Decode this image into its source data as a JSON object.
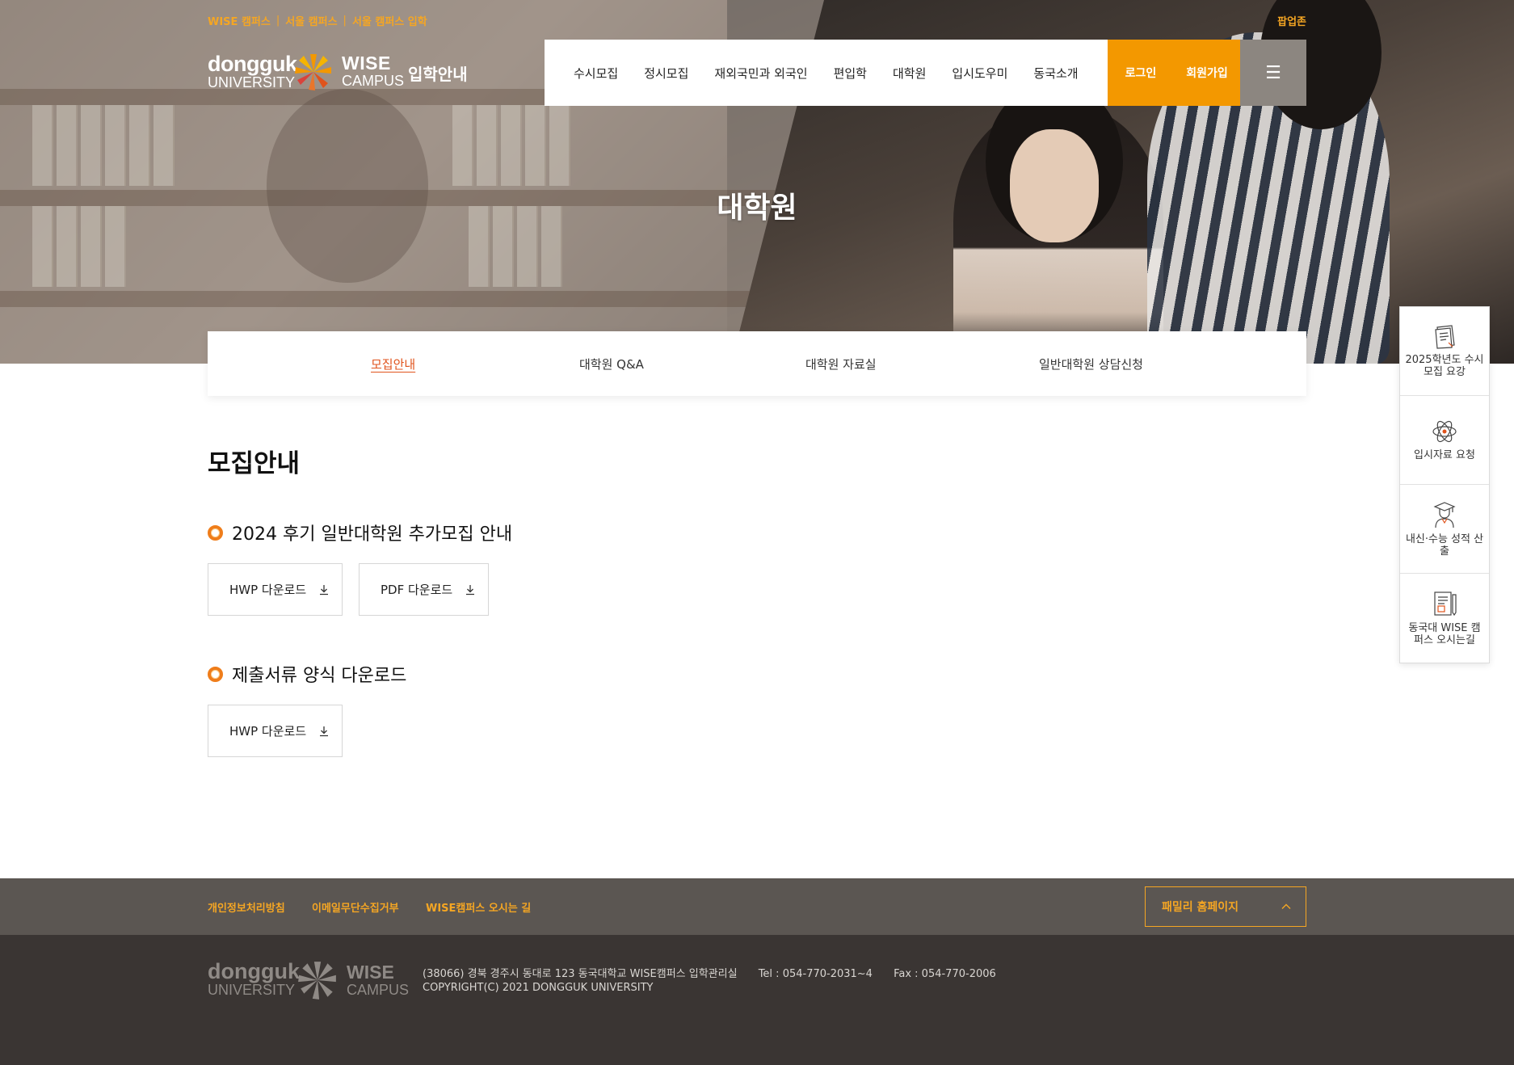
{
  "top_links": [
    "WISE 캠퍼스",
    "서울 캠퍼스",
    "서울 캠퍼스 입학"
  ],
  "popup_zone": "팝업존",
  "logo": {
    "dongguk": "dongguk",
    "university": "UNIVERSITY",
    "wise": "WISE",
    "campus": "CAMPUS",
    "title": "입학안내"
  },
  "nav": {
    "items": [
      "수시모집",
      "정시모집",
      "재외국민과 외국인",
      "편입학",
      "대학원",
      "입시도우미",
      "동국소개"
    ],
    "login": "로그인",
    "join": "회원가입",
    "menu_icon": "☰"
  },
  "hero": {
    "title": "대학원"
  },
  "tabs": [
    {
      "label": "모집안내",
      "active": true
    },
    {
      "label": "대학원 Q&A",
      "active": false
    },
    {
      "label": "대학원 자료실",
      "active": false
    },
    {
      "label": "일반대학원 상담신청",
      "active": false
    }
  ],
  "content": {
    "page_title": "모집안내",
    "sections": [
      {
        "title": "2024 후기 일반대학원 추가모집 안내",
        "buttons": [
          "HWP 다운로드",
          "PDF 다운로드"
        ]
      },
      {
        "title": "제출서류 양식 다운로드",
        "buttons": [
          "HWP 다운로드"
        ]
      }
    ]
  },
  "float_menu": [
    {
      "label": "2025학년도 수시모집 요강",
      "icon": "document-icon"
    },
    {
      "label": "입시자료 요청",
      "icon": "atom-icon"
    },
    {
      "label": "내신·수능 성적 산출",
      "icon": "graduate-icon"
    },
    {
      "label": "동국대 WISE 캠퍼스 오시는길",
      "icon": "map-document-icon"
    }
  ],
  "footer": {
    "links": [
      "개인정보처리방침",
      "이메일무단수집거부",
      "WISE캠퍼스 오시는 길"
    ],
    "family": "패밀리 홈페이지",
    "address": "(38066) 경북 경주시 동대로 123 동국대학교 WISE캠퍼스 입학관리실",
    "tel": "Tel : 054-770-2031~4",
    "fax": "Fax : 054-770-2006",
    "copyright": "COPYRIGHT(C) 2021 DONGGUK UNIVERSITY"
  },
  "colors": {
    "accent": "#f39800",
    "active_tab": "#e0531c",
    "footer_link": "#f5a623",
    "footer_top": "#5b5652",
    "footer_bottom": "#3a3533"
  }
}
